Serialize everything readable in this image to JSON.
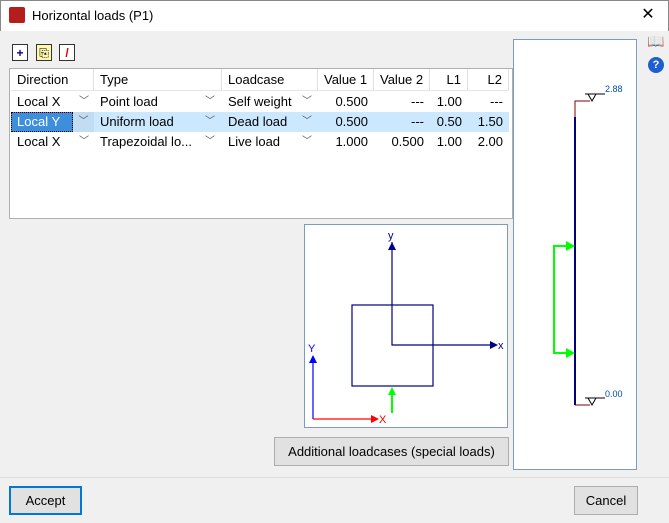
{
  "window": {
    "title": "Horizontal loads (P1)",
    "close": "✕"
  },
  "toolbar": {
    "add": "+",
    "copy": "⎘",
    "delete": "/"
  },
  "table": {
    "headers": [
      "Direction",
      "Type",
      "Loadcase",
      "Value 1",
      "Value 2",
      "L1",
      "L2"
    ],
    "rows": [
      [
        "Local X",
        "Point load",
        "Self weight",
        "0.500",
        "---",
        "1.00",
        "---"
      ],
      [
        "Local Y",
        "Uniform load",
        "Dead load",
        "0.500",
        "---",
        "0.50",
        "1.50"
      ],
      [
        "Local X",
        "Trapezoidal lo...",
        "Live load",
        "1.000",
        "0.500",
        "1.00",
        "2.00"
      ]
    ]
  },
  "diagram": {
    "local_y": "y",
    "local_x": "x",
    "global_y": "Y",
    "global_x": "X"
  },
  "elevation": {
    "top_level": "2.88",
    "bottom_level": "0.00"
  },
  "buttons": {
    "additional": "Additional loadcases (special loads)",
    "accept": "Accept",
    "cancel": "Cancel"
  },
  "side": {
    "help": "?",
    "manual": "📖"
  },
  "colors": {
    "accent": "#0078d7",
    "member": "#000080",
    "load": "#00ff00",
    "support": "#800000"
  }
}
